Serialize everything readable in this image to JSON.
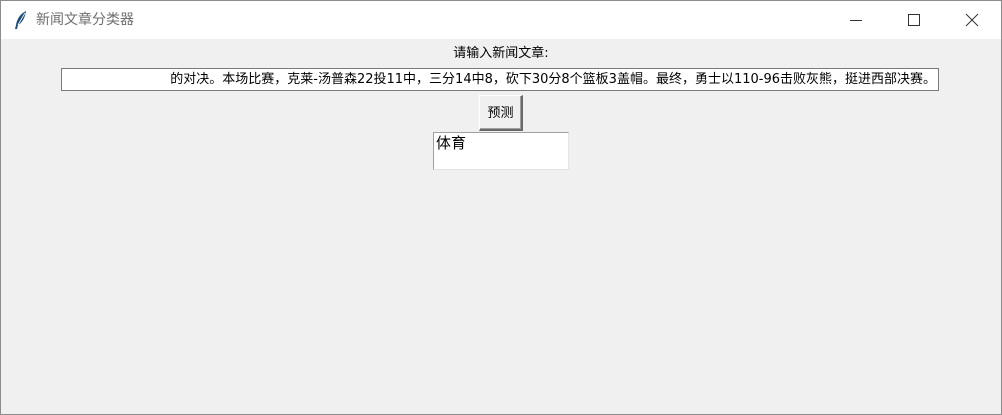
{
  "window": {
    "title": "新闻文章分类器",
    "icon": "feather-icon",
    "controls": [
      "minimize-icon",
      "maximize-icon",
      "close-icon"
    ]
  },
  "main": {
    "prompt_label": "请输入新闻文章:",
    "article_input": {
      "value": "的对决。本场比赛，克莱-汤普森22投11中，三分14中8，砍下30分8个篮板3盖帽。最终，勇士以110-96击败灰熊，挺进西部决赛。"
    },
    "predict_button_label": "预测",
    "result_text": "体育"
  },
  "colors": {
    "window_bg": "#f0f0f0",
    "titlebar_bg": "#ffffff",
    "title_text": "#6e6e6e",
    "icon_blue": "#1f4e79"
  }
}
